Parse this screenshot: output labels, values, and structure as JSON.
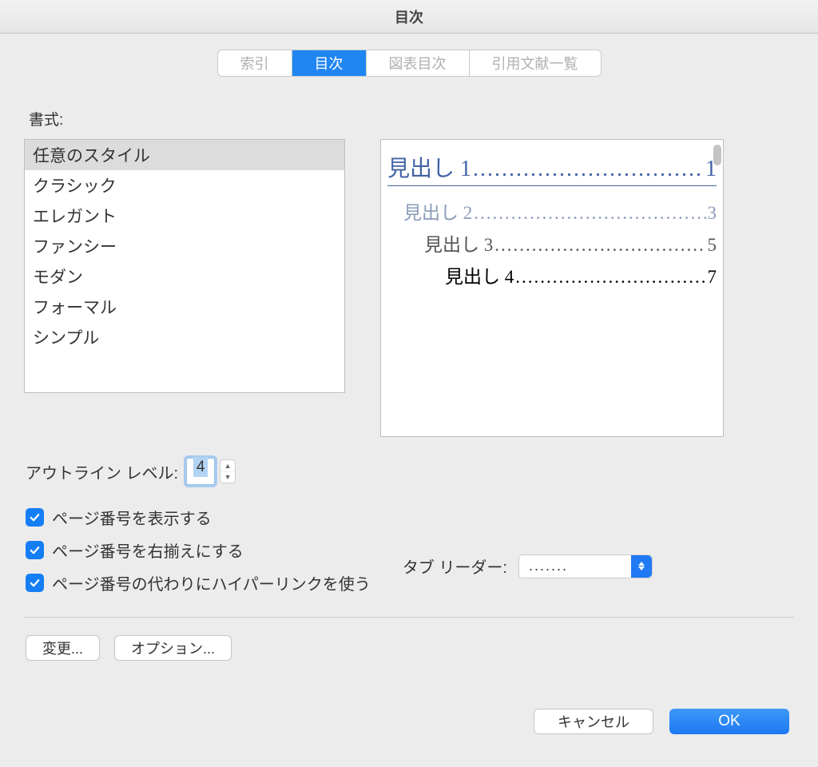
{
  "title": "目次",
  "tabs": [
    "索引",
    "目次",
    "図表目次",
    "引用文献一覧"
  ],
  "active_tab": 1,
  "format_label": "書式:",
  "styles": [
    "任意のスタイル",
    "クラシック",
    "エレガント",
    "ファンシー",
    "モダン",
    "フォーマル",
    "シンプル"
  ],
  "selected_style": 0,
  "preview": {
    "h1_label": "見出し 1",
    "h1_page": "1",
    "h2_label": "見出し 2",
    "h2_page": "3",
    "h3_label": "見出し 3",
    "h3_page": "5",
    "h4_label": "見出し 4",
    "h4_page": "7"
  },
  "outline": {
    "label": "アウトライン レベル:",
    "value": "4"
  },
  "checks": {
    "show_pagenum": "ページ番号を表示する",
    "right_align": "ページ番号を右揃えにする",
    "hyperlinks": "ページ番号の代わりにハイパーリンクを使う"
  },
  "tab_leader": {
    "label": "タブ リーダー:",
    "value": "......."
  },
  "buttons": {
    "modify": "変更...",
    "options": "オプション...",
    "cancel": "キャンセル",
    "ok": "OK"
  },
  "dots": "........................................................................"
}
